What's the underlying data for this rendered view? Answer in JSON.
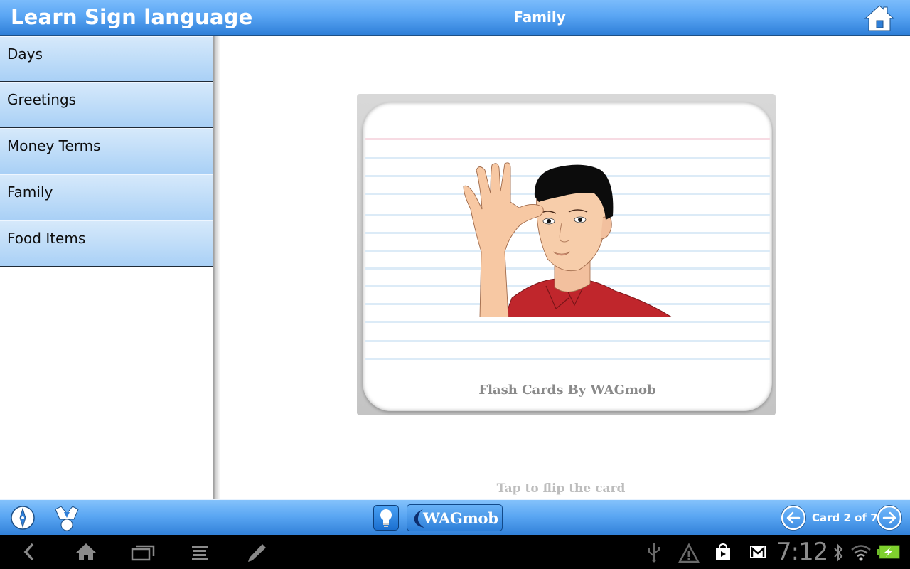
{
  "header": {
    "app_title": "Learn Sign language",
    "section_title": "Family",
    "home_icon": "home-icon"
  },
  "sidebar": {
    "items": [
      {
        "label": "Days"
      },
      {
        "label": "Greetings"
      },
      {
        "label": "Money Terms"
      },
      {
        "label": "Family"
      },
      {
        "label": "Food Items"
      }
    ]
  },
  "card": {
    "illustration": "man-signing-family-illustration",
    "caption": "Flash Cards By WAGmob"
  },
  "flip_hint": "Tap to flip the card",
  "bottombar": {
    "compass_icon": "compass-icon",
    "award_icon": "award-ribbon-icon",
    "tip_icon": "lightbulb-icon",
    "brand_label": "WAGmob",
    "counter": "Card 2 of 7",
    "current_card": 2,
    "total_cards": 7
  },
  "system_bar": {
    "time": "7:12",
    "icons": [
      "back-icon",
      "home-icon",
      "recent-apps-icon",
      "menu-icon",
      "pencil-icon",
      "usb-icon",
      "warning-icon",
      "play-store-icon",
      "gmail-icon",
      "bluetooth-icon",
      "wifi-icon",
      "battery-charging-icon"
    ]
  },
  "colors": {
    "bar_top": "#7bbcfb",
    "bar_bottom": "#2f7fd8",
    "menu_item": "#c0ddf8",
    "caption_gray": "#8a8a8a",
    "shirt_red": "#c0262c"
  }
}
